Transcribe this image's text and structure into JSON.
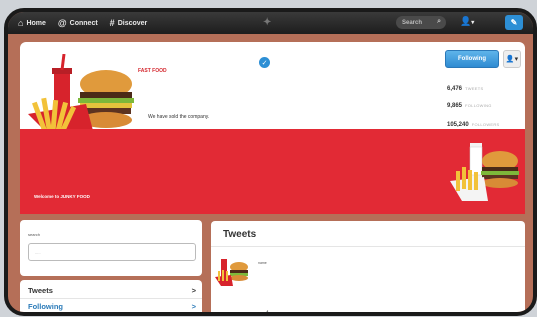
{
  "topbar": {
    "home": "Home",
    "connect": "Connect",
    "discover": "Discover",
    "search_placeholder": "Search",
    "user_icon": "person-icon",
    "compose_icon": "compose-icon"
  },
  "profile": {
    "name": "FAST FOOD",
    "bio": "We have sold the company.",
    "follow_label": "Following",
    "stats": [
      {
        "num": "6,476",
        "label": "TWEETS"
      },
      {
        "num": "9,865",
        "label": "FOLLOWING"
      },
      {
        "num": "105,240",
        "label": "FOLLOWERS"
      }
    ]
  },
  "banner": {
    "welcome": "Welcome to JUNKY FOOD"
  },
  "leftcard": {
    "label": "search",
    "input_placeholder": "....."
  },
  "nav": [
    {
      "label": "Tweets",
      "chevron": ">"
    },
    {
      "label": "Following",
      "chevron": ">"
    }
  ],
  "tweets": {
    "title": "Tweets",
    "first_name": "name",
    "number": "1"
  },
  "colors": {
    "accent": "#2d8fd5",
    "banner": "#e22a35",
    "frame_bg": "#b56f58"
  }
}
